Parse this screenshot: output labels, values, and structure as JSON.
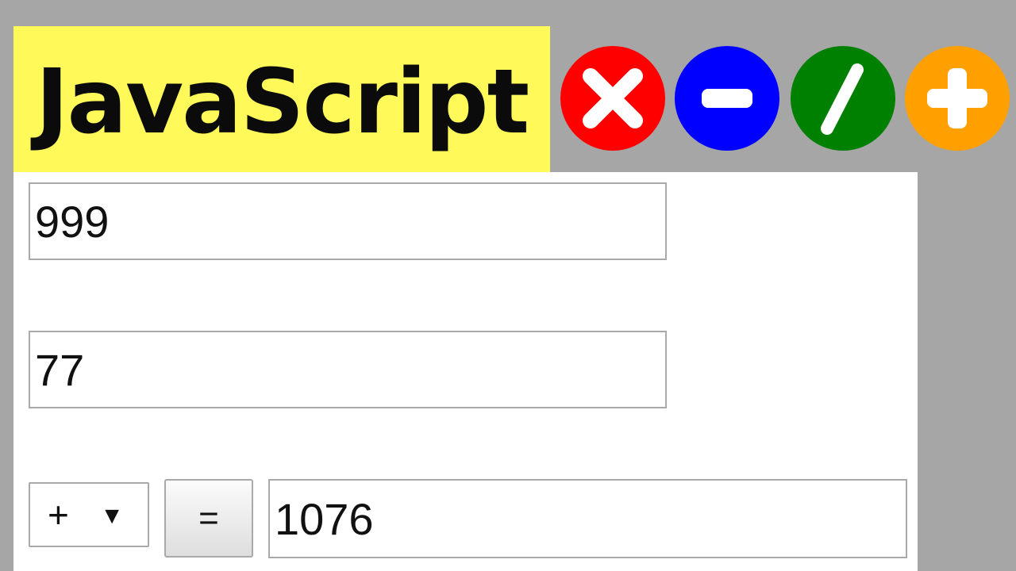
{
  "banner": {
    "title": "JavaScript"
  },
  "operator_icons": [
    {
      "name": "multiply-icon",
      "color": "#ff0000"
    },
    {
      "name": "subtract-icon",
      "color": "#0000ff"
    },
    {
      "name": "divide-icon",
      "color": "#008000"
    },
    {
      "name": "add-icon",
      "color": "#ffa000"
    }
  ],
  "calculator": {
    "first_value": "999",
    "second_value": "77",
    "operator": "+",
    "operator_arrow": "▼",
    "equals_label": "=",
    "result": "1076"
  }
}
